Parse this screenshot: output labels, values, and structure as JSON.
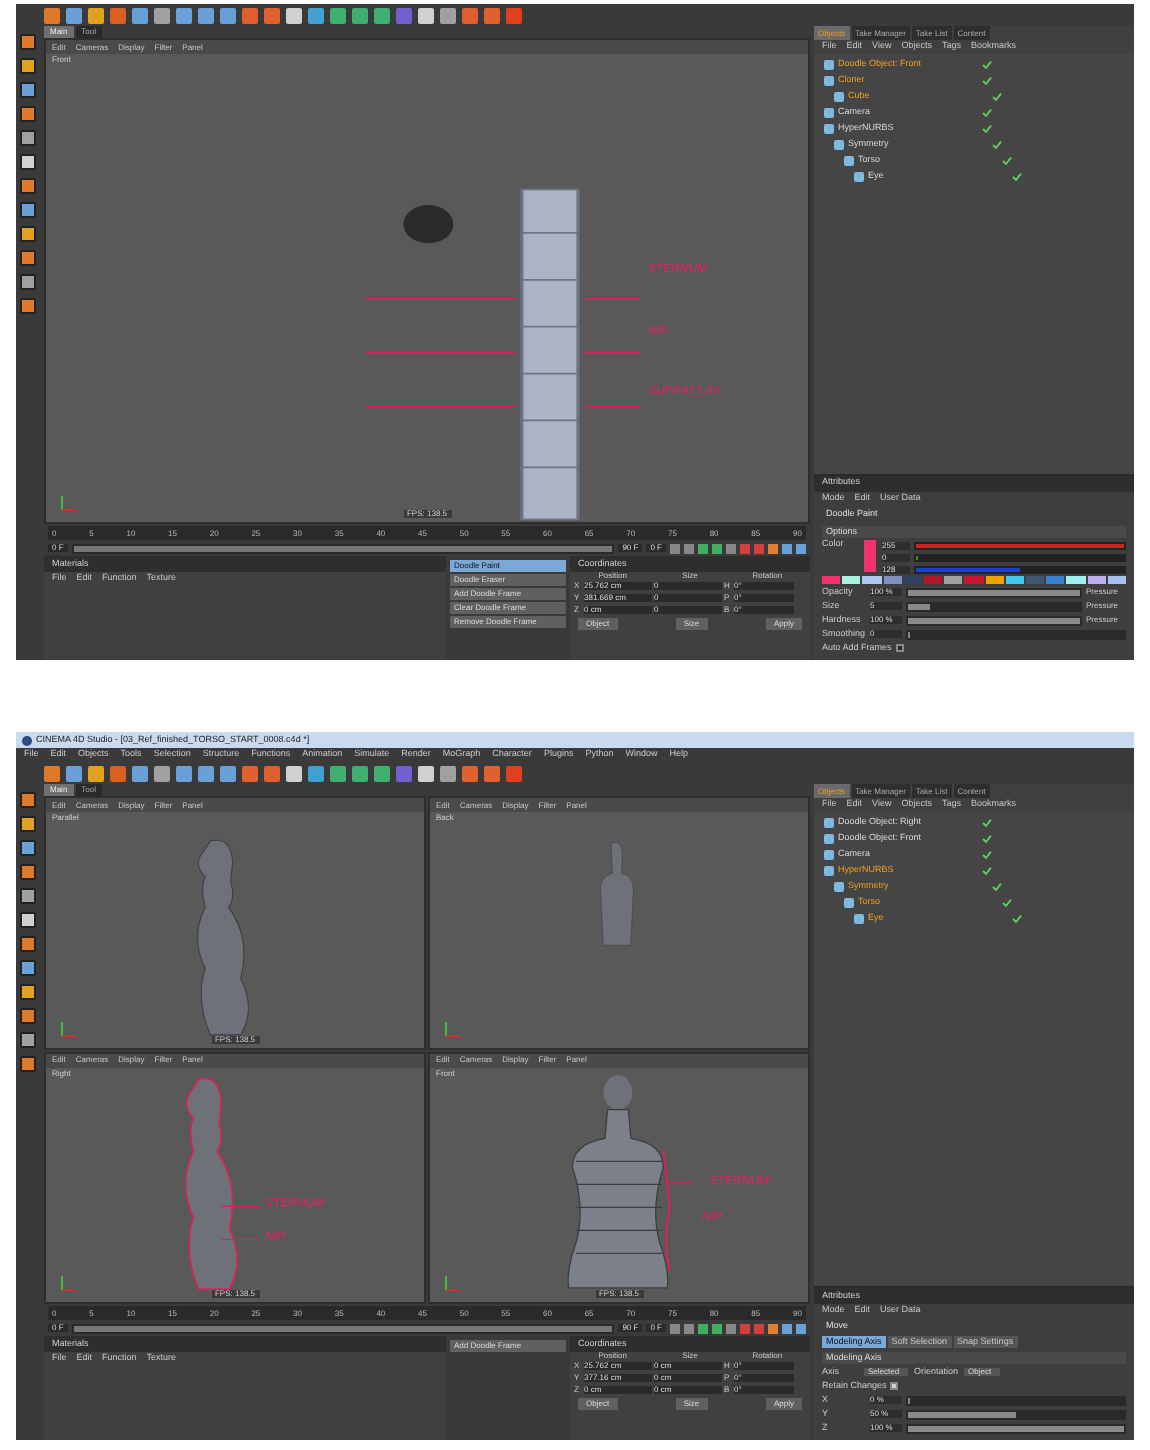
{
  "screens": [
    {
      "viewport_tabs": [
        {
          "label": "Main",
          "selected": true
        },
        {
          "label": "Tool",
          "selected": false
        }
      ],
      "viewports": [
        {
          "kind": "column",
          "label": "Front",
          "menu": [
            "Edit",
            "Cameras",
            "Display",
            "Filter",
            "Panel"
          ],
          "annotations": [
            "STERNUM",
            "NIP",
            "SUPRACLAV"
          ],
          "fps": "FPS: 138.5"
        }
      ],
      "manager_tabs": [
        {
          "label": "Objects",
          "selected": true
        },
        {
          "label": "Take Manager",
          "selected": false
        },
        {
          "label": "Take List",
          "selected": false
        },
        {
          "label": "Content",
          "selected": false
        }
      ],
      "objects_menu": [
        "File",
        "Edit",
        "View",
        "Objects",
        "Tags",
        "Bookmarks"
      ],
      "objects": [
        {
          "name": "Doodle Object: Front",
          "active": true
        },
        {
          "name": "Cloner",
          "active": true,
          "children": [
            {
              "name": "Cube",
              "active": true
            }
          ]
        },
        {
          "name": "Camera",
          "active": false
        },
        {
          "name": "HyperNURBS",
          "active": false,
          "children": [
            {
              "name": "Symmetry",
              "active": false,
              "children": [
                {
                  "name": "Torso",
                  "active": false,
                  "children": [
                    {
                      "name": "Eye",
                      "active": false
                    }
                  ]
                }
              ]
            }
          ]
        }
      ],
      "attributes": {
        "title": "Attributes",
        "menu": [
          "Mode",
          "Edit",
          "User Data"
        ],
        "tool": "Doodle Paint",
        "section": "Options",
        "color": {
          "label": "Color",
          "channels": [
            {
              "value": "255",
              "level": 1,
              "color": "#d02020"
            },
            {
              "value": "0",
              "level": 0.0,
              "color": "#20a020"
            },
            {
              "value": "128",
              "level": 0.5,
              "color": "#2040d0"
            }
          ],
          "palette": [
            {
              "color": "#f0326e"
            },
            {
              "color": "#a8f0e0"
            },
            {
              "color": "#b0c8f0"
            },
            {
              "color": "#8090c0"
            },
            {
              "color": "#304060"
            },
            {
              "color": "#b01828"
            },
            {
              "color": "#a0a0a0"
            },
            {
              "color": "#c81830"
            },
            {
              "color": "#f0a000"
            },
            {
              "color": "#40c8f0"
            },
            {
              "color": "#405870"
            },
            {
              "color": "#3880d0"
            },
            {
              "color": "#a0f0f0"
            },
            {
              "color": "#c0b0f0"
            },
            {
              "color": "#a8c0f0"
            }
          ]
        },
        "rows": [
          {
            "kind": "slider",
            "label": "Opacity",
            "value": "100 %",
            "level": 1,
            "option": "Pressure"
          },
          {
            "kind": "slider",
            "label": "Size",
            "value": "5",
            "level": 0.13,
            "option": "Pressure"
          },
          {
            "kind": "slider",
            "label": "Hardness",
            "value": "100 %",
            "level": 1,
            "option": "Pressure"
          },
          {
            "kind": "slider",
            "label": "Smoothing",
            "value": "0",
            "level": 0.0
          },
          {
            "kind": "check",
            "label": "Auto Add Frames",
            "checked": false
          }
        ]
      },
      "timeline": {
        "ticks": [
          "0",
          "5",
          "10",
          "15",
          "20",
          "25",
          "30",
          "35",
          "40",
          "45",
          "50",
          "55",
          "60",
          "65",
          "70",
          "75",
          "80",
          "85",
          "90"
        ],
        "start": "0 F",
        "end": "90 F",
        "current": "0 F",
        "level": 1
      },
      "materials": {
        "title": "Materials",
        "menu": [
          "File",
          "Edit",
          "Function",
          "Texture"
        ]
      },
      "doodle_tools": [
        {
          "label": "Doodle Paint",
          "selected": true
        },
        {
          "label": "Doodle Eraser",
          "selected": false
        },
        {
          "label": "Add Doodle Frame",
          "selected": false
        },
        {
          "label": "Clear Doodle Frame",
          "selected": false
        },
        {
          "label": "Remove Doodle Frame",
          "selected": false
        }
      ],
      "coordinates": {
        "title": "Coordinates",
        "headers": [
          "Position",
          "Size",
          "Rotation"
        ],
        "rows": [
          [
            "X",
            "25.762 cm",
            "0",
            "H",
            "0°"
          ],
          [
            "Y",
            "381.669 cm",
            "0",
            "P",
            "0°"
          ],
          [
            "Z",
            "0 cm",
            "0",
            "B",
            "0°"
          ]
        ],
        "buttons": [
          "Object",
          "Size",
          "Apply"
        ]
      }
    },
    {
      "title": "CINEMA 4D Studio - [03_Ref_finished_TORSO_START_0008.c4d *]",
      "menu": [
        "File",
        "Edit",
        "Objects",
        "Tools",
        "Selection",
        "Structure",
        "Functions",
        "Animation",
        "Simulate",
        "Render",
        "MoGraph",
        "Character",
        "Plugins",
        "Python",
        "Window",
        "Help"
      ],
      "viewport_tabs": [
        {
          "label": "Main",
          "selected": true
        },
        {
          "label": "Tool",
          "selected": false
        }
      ],
      "viewports": [
        {
          "kind": "side",
          "label": "Parallel",
          "menu": [
            "Edit",
            "Cameras",
            "Display",
            "Filter",
            "Panel"
          ],
          "fps": "FPS: 138.5"
        },
        {
          "kind": "back",
          "label": "Back",
          "menu": [
            "Edit",
            "Cameras",
            "Display",
            "Filter",
            "Panel"
          ]
        },
        {
          "kind": "sidedoodle",
          "label": "Right",
          "menu": [
            "Edit",
            "Cameras",
            "Display",
            "Filter",
            "Panel"
          ],
          "annotations": [
            "STERNUM",
            "NIP"
          ],
          "fps": "FPS: 138.5"
        },
        {
          "kind": "front",
          "label": "Front",
          "menu": [
            "Edit",
            "Cameras",
            "Display",
            "Filter",
            "Panel"
          ],
          "annotations": [
            "STERNUM",
            "NIP"
          ],
          "fps": "FPS: 138.5"
        }
      ],
      "manager_tabs": [
        {
          "label": "Objects",
          "selected": true
        },
        {
          "label": "Take Manager",
          "selected": false
        },
        {
          "label": "Take List",
          "selected": false
        },
        {
          "label": "Content",
          "selected": false
        }
      ],
      "objects_menu": [
        "File",
        "Edit",
        "View",
        "Objects",
        "Tags",
        "Bookmarks"
      ],
      "objects": [
        {
          "name": "Doodle Object: Right",
          "active": false
        },
        {
          "name": "Doodle Object: Front",
          "active": false
        },
        {
          "name": "Camera",
          "active": false
        },
        {
          "name": "HyperNURBS",
          "active": true,
          "children": [
            {
              "name": "Symmetry",
              "active": true,
              "children": [
                {
                  "name": "Torso",
                  "active": true,
                  "children": [
                    {
                      "name": "Eye",
                      "active": true
                    }
                  ]
                }
              ]
            }
          ]
        }
      ],
      "attributes": {
        "title": "Attributes",
        "menu": [
          "Mode",
          "Edit",
          "User Data"
        ],
        "tool": "Move",
        "tabs": [
          {
            "label": "Modeling Axis",
            "selected": true
          },
          {
            "label": "Soft Selection",
            "selected": false
          },
          {
            "label": "Snap Settings",
            "selected": false
          }
        ],
        "section": "Modeling Axis",
        "rows": [
          {
            "kind": "select",
            "label": "Axis",
            "value": "Selected",
            "label2": "Orientation",
            "value2": "Object"
          },
          {
            "kind": "check",
            "label": "Retain Changes",
            "checked": true
          },
          {
            "kind": "slider",
            "label": "X",
            "value": "0 %",
            "level": 0.0
          },
          {
            "kind": "slider",
            "label": "Y",
            "value": "50 %",
            "level": 0.5
          },
          {
            "kind": "slider",
            "label": "Z",
            "value": "100 %",
            "level": 1
          }
        ]
      },
      "timeline": {
        "ticks": [
          "0",
          "5",
          "10",
          "15",
          "20",
          "25",
          "30",
          "35",
          "40",
          "45",
          "50",
          "55",
          "60",
          "65",
          "70",
          "75",
          "80",
          "85",
          "90"
        ],
        "start": "0 F",
        "end": "90 F",
        "current": "0 F",
        "level": 1
      },
      "materials": {
        "title": "Materials",
        "menu": [
          "File",
          "Edit",
          "Function",
          "Texture"
        ]
      },
      "doodle_tools": [
        {
          "label": "Add Doodle Frame",
          "selected": false
        }
      ],
      "coordinates": {
        "title": "Coordinates",
        "headers": [
          "Position",
          "Size",
          "Rotation"
        ],
        "rows": [
          [
            "X",
            "25.762 cm",
            "0 cm",
            "H",
            "0°"
          ],
          [
            "Y",
            "377.16 cm",
            "0 cm",
            "P",
            "0°"
          ],
          [
            "Z",
            "0 cm",
            "0 cm",
            "B",
            "0°"
          ]
        ],
        "buttons": [
          "Object",
          "Size",
          "Apply"
        ]
      }
    }
  ]
}
